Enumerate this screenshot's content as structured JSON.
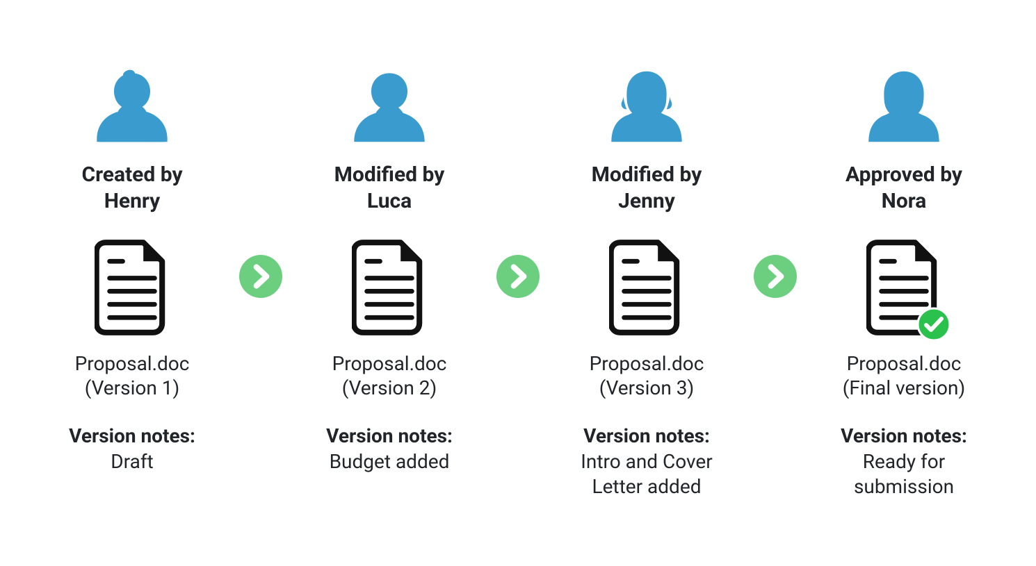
{
  "steps": [
    {
      "avatar_type": "male",
      "action_line1": "Created by",
      "action_line2": "Henry",
      "file_line1": "Proposal.doc",
      "file_line2": "(Version 1)",
      "notes_label": "Version notes:",
      "notes_line1": "Draft",
      "notes_line2": "",
      "approved": false
    },
    {
      "avatar_type": "male",
      "action_line1": "Modified by",
      "action_line2": "Luca",
      "file_line1": "Proposal.doc",
      "file_line2": "(Version 2)",
      "notes_label": "Version notes:",
      "notes_line1": "Budget added",
      "notes_line2": "",
      "approved": false
    },
    {
      "avatar_type": "female",
      "action_line1": "Modified by",
      "action_line2": "Jenny",
      "file_line1": "Proposal.doc",
      "file_line2": "(Version 3)",
      "notes_label": "Version notes:",
      "notes_line1": "Intro and Cover",
      "notes_line2": "Letter added",
      "approved": false
    },
    {
      "avatar_type": "female",
      "action_line1": "Approved by",
      "action_line2": "Nora",
      "file_line1": "Proposal.doc",
      "file_line2": "(Final version)",
      "notes_label": "Version notes:",
      "notes_line1": "Ready for",
      "notes_line2": "submission",
      "approved": true
    }
  ],
  "colors": {
    "avatar": "#3a9bce",
    "arrow_bg": "#6bcf7f",
    "approved_bg": "#2ac24c",
    "text": "#212529"
  }
}
